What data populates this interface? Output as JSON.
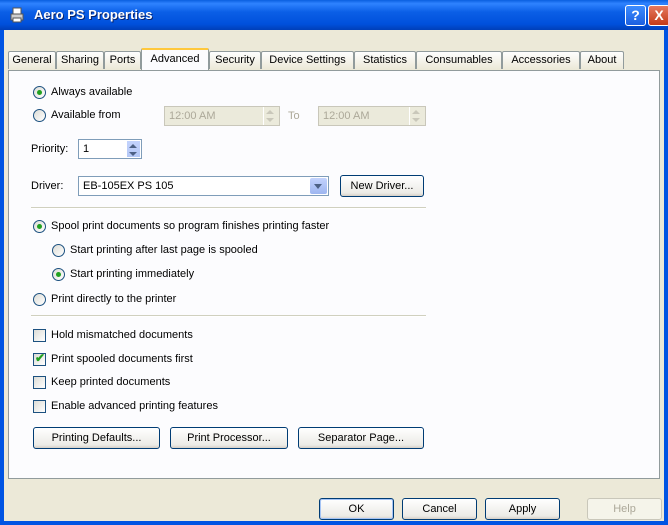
{
  "window": {
    "title": "Aero PS Properties",
    "help_glyph": "?",
    "close_glyph": "X"
  },
  "tabs": [
    "General",
    "Sharing",
    "Ports",
    "Advanced",
    "Security",
    "Device Settings",
    "Statistics",
    "Consumables",
    "Accessories",
    "About"
  ],
  "availability": {
    "always_label": "Always available",
    "from_label": "Available from",
    "from_time": "12:00 AM",
    "to_label": "To",
    "to_time": "12:00 AM"
  },
  "priority": {
    "label": "Priority:",
    "value": "1"
  },
  "driver": {
    "label": "Driver:",
    "value": "EB-105EX PS 105",
    "new_button": "New Driver..."
  },
  "spool": {
    "spool_label": "Spool print documents so program finishes printing faster",
    "after_last_label": "Start printing after last page is spooled",
    "immediately_label": "Start printing immediately",
    "direct_label": "Print directly to the printer"
  },
  "options": {
    "hold_label": "Hold mismatched documents",
    "spooled_first_label": "Print spooled documents first",
    "keep_label": "Keep printed documents",
    "advanced_label": "Enable advanced printing features"
  },
  "panel_buttons": {
    "defaults": "Printing Defaults...",
    "processor": "Print Processor...",
    "separator": "Separator Page..."
  },
  "dialog_buttons": {
    "ok": "OK",
    "cancel": "Cancel",
    "apply": "Apply",
    "help": "Help"
  },
  "colors": {
    "title_bar": "#0054e3",
    "dialog_bg": "#ece9d8",
    "radio_dot": "#21a121",
    "tab_highlight": "#ffc83c"
  }
}
